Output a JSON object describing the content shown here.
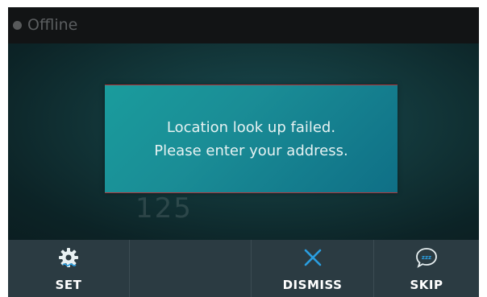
{
  "status": {
    "label": "Offline"
  },
  "background": {
    "digits": "125"
  },
  "dialog": {
    "line1": "Location look up failed.",
    "line2": "Please enter your address."
  },
  "buttons": [
    {
      "label": "SET",
      "icon": "gear-icon"
    },
    {
      "label": "",
      "icon": ""
    },
    {
      "label": "DISMISS",
      "icon": "close-icon"
    },
    {
      "label": "SKIP",
      "icon": "sleep-bubble-icon"
    }
  ],
  "colors": {
    "accent": "#2a9ee0",
    "dialog": "#1a8d96",
    "bar": "#2b3b42",
    "dialog_border": "#b0353a"
  }
}
